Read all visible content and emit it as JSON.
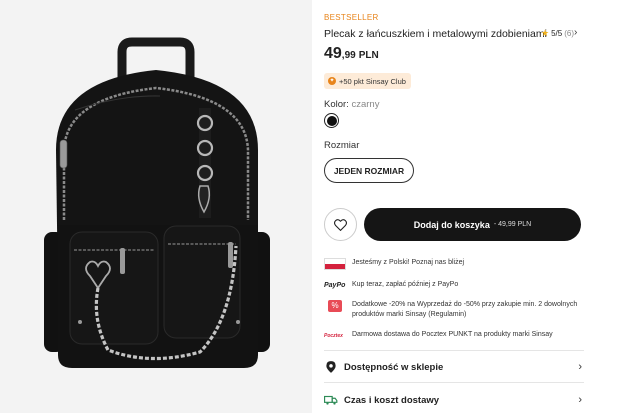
{
  "product": {
    "badge": "BESTSELLER",
    "title": "Plecak z łańcuszkiem i metalowymi zdobieniami",
    "rating": {
      "star": "★",
      "score": "5/5",
      "count": "(6)"
    },
    "price": {
      "main": "49",
      "cents": ",99",
      "currency": "PLN"
    },
    "club_badge": "+50 pkt Sinsay Club",
    "color_label": "Kolor:",
    "color_value": "czarny",
    "size_label": "Rozmiar",
    "size_option": "JEDEN ROZMIAR"
  },
  "cta": {
    "add_label": "Dodaj do koszyka",
    "add_price": "- 49,99 PLN"
  },
  "info": [
    {
      "icon": "poland-flag-icon",
      "text": "Jesteśmy z Polski! Poznaj nas bliżej"
    },
    {
      "icon": "paypo-logo",
      "logo_text": "PayPo",
      "text": "Kup teraz, zapłać później z PayPo"
    },
    {
      "icon": "discount-icon",
      "logo_text": "%",
      "text": "Dodatkowe -20% na Wyprzedaż do -50% przy zakupie min. 2 dowolnych produktów marki Sinsay (Regulamin)"
    },
    {
      "icon": "pocztex-logo",
      "logo_text": "Pocztex",
      "text": "Darmowa dostawa do Pocztex PUNKT na produkty marki Sinsay"
    }
  ],
  "rows": [
    {
      "icon": "location-pin-icon",
      "label": "Dostępność w sklepie"
    },
    {
      "icon": "delivery-truck-icon",
      "label": "Czas i koszt dostawy"
    }
  ],
  "colors": {
    "accent": "#e8841a",
    "cta_bg": "#151515",
    "flag_red": "#d4213d",
    "delivery_green": "#2e8b57"
  }
}
